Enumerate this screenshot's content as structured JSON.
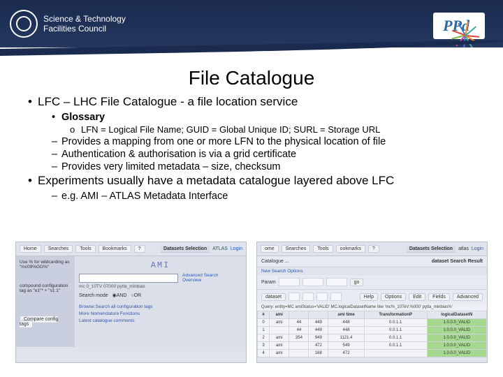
{
  "header": {
    "org_line1": "Science & Technology",
    "org_line2": "Facilities Council",
    "ppd": "PPd"
  },
  "title": "File Catalogue",
  "bullets": {
    "b1": "LFC – LHC File Catalogue - a file location service",
    "b1a": "Glossary",
    "b1a1": "LFN = Logical File Name;  GUID = Global Unique ID;  SURL = Storage URL",
    "b1b": "Provides a mapping from one or more LFN to the physical location of file",
    "b1c": "Authentication & authorisation is via a grid certificate",
    "b1d": "Provides very limited metadata – size, checksum",
    "b2": "Experiments usually have a metadata catalogue layered above LFC",
    "b2a": "e.g. AMI – ATLAS Metadata Interface"
  },
  "ami_left": {
    "nav": [
      "Home",
      "Searches",
      "Tools",
      "Bookmarks",
      "?"
    ],
    "panel_title": "Datasets Selection",
    "atlas_label": "ATLAS",
    "login": "Login",
    "side_hint": "Use % for wildcarding as \"mc09%GG%\"",
    "side_hint2": "compound configuration tag as \"e1\"* + \"s1 1\"",
    "logo": "AMI",
    "placeholder": "mc 0_10TV 07000 pytla_minbias",
    "adv": "Advanced Search",
    "overview": "Overview",
    "search_mode": "Search mode",
    "and": "AND",
    "or": "OR",
    "link1": "Browse:Search all configuration tags",
    "link2": "More Nomenclature Functions",
    "link3": "Latest catalogue comments",
    "compare": "Compare config tags"
  },
  "ami_right": {
    "nav": [
      "ome",
      "Searches",
      "Tools",
      "ookmarks",
      "?"
    ],
    "panel_title": "Datasets Selection",
    "atlas_label": "atlas",
    "login": "Login",
    "crumb": "Catalogue ...",
    "result_title": "dataset Search Result",
    "new_search": "New Search Options",
    "param": "Param",
    "go": "go",
    "dataset": "dataset",
    "help_btns": [
      "Help",
      "Options",
      "Edit",
      "Fields",
      "Advanced"
    ],
    "query_line": "Query: entity=MC amiStatus='VALID' MC.logicalDatasetName like 'mc%_10TeV.%000' pytla_minbias%'",
    "headers": [
      "#",
      "ami",
      "",
      "",
      "",
      "",
      "",
      "ami time",
      "",
      "TransformationP",
      "logicalDatasetN"
    ],
    "rows": [
      {
        "n": "0",
        "c1": "ami",
        "c5": "44",
        "c6": "449",
        "c7": "448",
        "c8": "0.0.1.1",
        "g": "1.0.0.0_VALID"
      },
      {
        "n": "1",
        "c1": "",
        "c5": "44",
        "c6": "449",
        "c7": "448",
        "c8": "0.0.1.1",
        "g": "1.0.0.0_VALID"
      },
      {
        "n": "2",
        "c1": "ami",
        "c5": "354",
        "c6": "949",
        "c7": "1121.4",
        "c8": "0.0.1.1",
        "g": "1.0.0.0_VALID"
      },
      {
        "n": "3",
        "c1": "ami",
        "c5": "",
        "c6": "472",
        "c7": "549",
        "c8": "0.0.1.1",
        "g": "1.0.0.0_VALID"
      },
      {
        "n": "4",
        "c1": "ami",
        "c5": "",
        "c6": "168",
        "c7": "472",
        "c8": "",
        "g": "1.0.0.0_VALID"
      }
    ]
  }
}
